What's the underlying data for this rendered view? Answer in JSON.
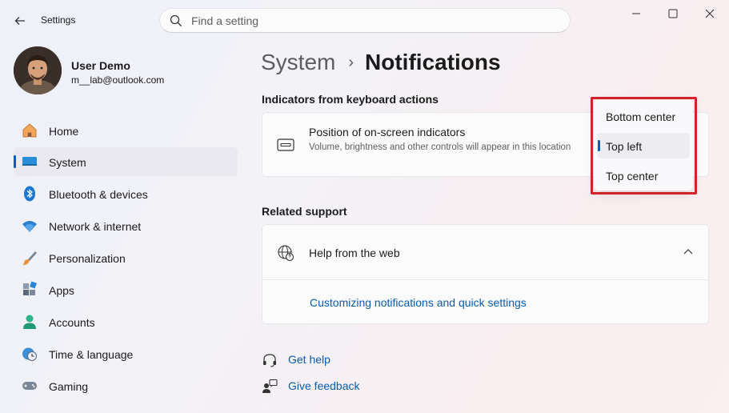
{
  "app": {
    "title": "Settings"
  },
  "search": {
    "placeholder": "Find a setting"
  },
  "profile": {
    "name": "User Demo",
    "email": "m__lab@outlook.com"
  },
  "nav": {
    "items": [
      {
        "label": "Home",
        "icon": "home-icon"
      },
      {
        "label": "System",
        "icon": "system-icon",
        "active": true
      },
      {
        "label": "Bluetooth & devices",
        "icon": "bluetooth-icon"
      },
      {
        "label": "Network & internet",
        "icon": "wifi-icon"
      },
      {
        "label": "Personalization",
        "icon": "brush-icon"
      },
      {
        "label": "Apps",
        "icon": "apps-icon"
      },
      {
        "label": "Accounts",
        "icon": "accounts-icon"
      },
      {
        "label": "Time & language",
        "icon": "clock-globe-icon"
      },
      {
        "label": "Gaming",
        "icon": "gamepad-icon"
      }
    ]
  },
  "breadcrumb": {
    "parent": "System",
    "separator": "›",
    "current": "Notifications"
  },
  "indicators_section": {
    "title": "Indicators from keyboard actions",
    "setting": {
      "title": "Position of on-screen indicators",
      "description": "Volume, brightness and other controls will appear in this location",
      "icon": "indicator-icon"
    }
  },
  "dropdown": {
    "options": [
      "Bottom center",
      "Top left",
      "Top center"
    ],
    "selected": "Top left"
  },
  "related_section": {
    "title": "Related support",
    "help_card": {
      "title": "Help from the web",
      "icon": "globe-help-icon",
      "expanded": true
    },
    "link": "Customizing notifications and quick settings"
  },
  "footer_links": {
    "get_help": "Get help",
    "give_feedback": "Give feedback"
  },
  "colors": {
    "accent": "#005fb8",
    "link": "#0a5cae",
    "highlight": "#d2232a"
  }
}
